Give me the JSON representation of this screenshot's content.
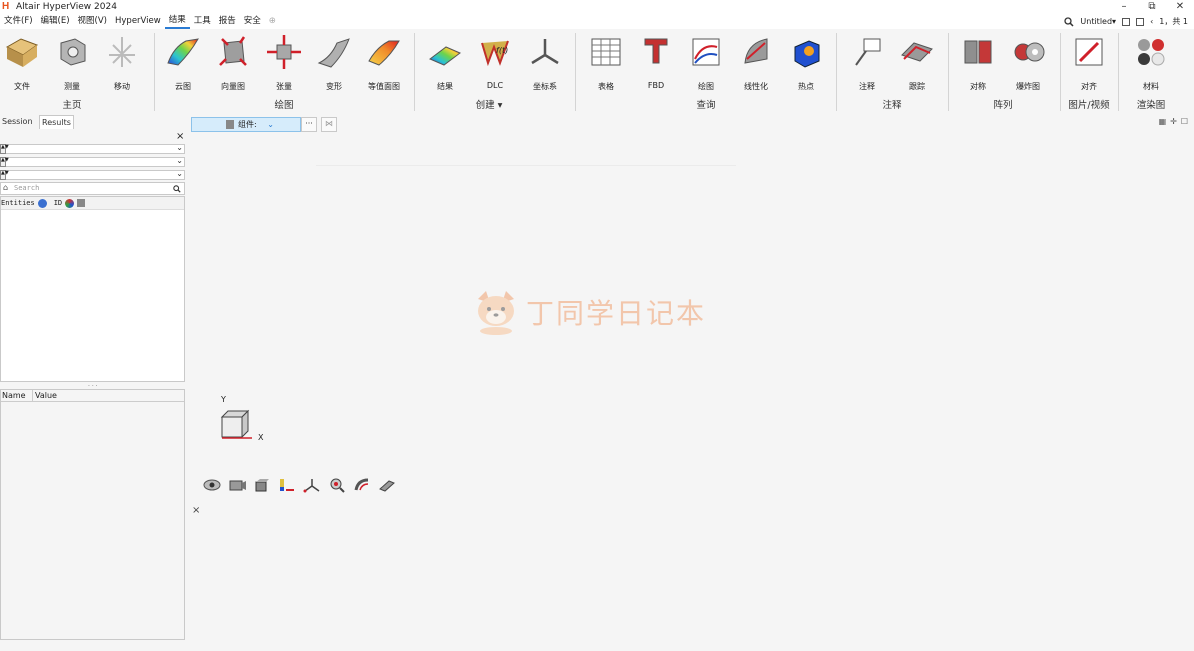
{
  "app": {
    "logo_letter": "H",
    "title": "Altair HyperView 2024"
  },
  "window_controls": {
    "minimize": "–",
    "maximize": "⧉",
    "close": "✕"
  },
  "menu": {
    "items": [
      {
        "label": "文件(F)",
        "active": false
      },
      {
        "label": "编辑(E)",
        "active": false
      },
      {
        "label": "视图(V)",
        "active": false
      },
      {
        "label": "HyperView",
        "active": false
      },
      {
        "label": "结果",
        "active": true
      },
      {
        "label": "工具",
        "active": false
      },
      {
        "label": "报告",
        "active": false
      },
      {
        "label": "安全",
        "active": false
      }
    ],
    "add_symbol": "⊕",
    "session_name": "Untitled",
    "page_label": "1，共 1"
  },
  "ribbon": {
    "buttons": {
      "file": "文件",
      "measure": "测量",
      "move": "移动",
      "contour": "云图",
      "vector": "向量图",
      "tensor": "张量",
      "deform": "变形",
      "isosurface": "等值面图",
      "result": "结果",
      "dlc": "DLC",
      "coord_sys": "坐标系",
      "table": "表格",
      "fbd": "FBD",
      "plot": "绘图",
      "linearize": "线性化",
      "hotspot": "热点",
      "note": "注释",
      "track": "跟踪",
      "symmetry": "对称",
      "explode": "爆炸图",
      "align": "对齐",
      "material": "材料"
    },
    "groups": {
      "home": "主页",
      "draw": "绘图",
      "create": "创建",
      "query": "查询",
      "annotate": "注释",
      "array": "阵列",
      "image_video": "图片/视频",
      "render": "渲染图"
    }
  },
  "left_panel": {
    "tabs": [
      {
        "label": "Session",
        "active": false
      },
      {
        "label": "Results",
        "active": true
      }
    ],
    "search_placeholder": "Search",
    "columns": [
      "Entities",
      "ID"
    ],
    "prop_columns": [
      "Name",
      "Value"
    ]
  },
  "viewport": {
    "component_selector": "组件:",
    "more_btn": "···",
    "axis_y": "Y",
    "axis_x": "X",
    "close_symbol": "×",
    "watermark": "丁同学日记本"
  },
  "colors": {
    "accent": "#2a7bd3",
    "selector_bg": "#d6ecfb",
    "watermark": "#f0a070",
    "logo": "#e8541e"
  }
}
